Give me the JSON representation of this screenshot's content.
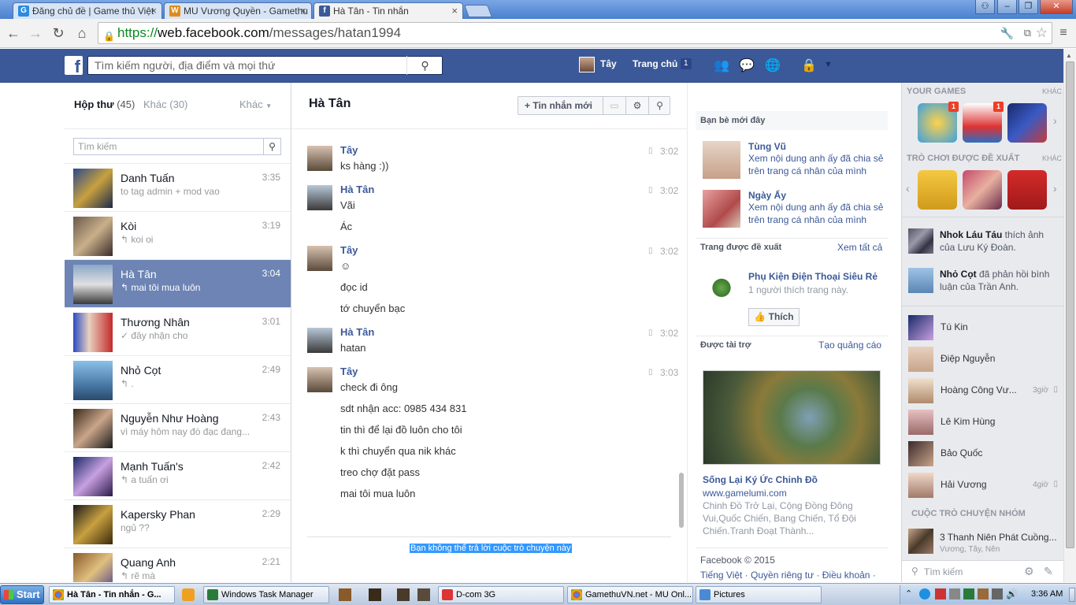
{
  "browser": {
    "tabs": [
      {
        "label": "Đăng chủ đề | Game thủ Việt",
        "icon": "g-icon"
      },
      {
        "label": "MU Vương Quyền - Gamethu",
        "icon": "mu-icon"
      },
      {
        "label": "Hà Tân - Tin nhắn",
        "icon": "facebook-icon"
      }
    ],
    "url_scheme": "https://",
    "url_host": "web.facebook.com",
    "url_path": "/messages/hatan1994"
  },
  "fb_header": {
    "search_placeholder": "Tìm kiếm người, địa điểm và mọi thứ",
    "user_name": "Tây",
    "home_label": "Trang chủ",
    "home_count": "1"
  },
  "inbox": {
    "tab_inbox": "Hộp thư",
    "tab_inbox_count": "(45)",
    "tab_other": "Khác",
    "tab_other_count": "(30)",
    "more_label": "Khác",
    "search_placeholder": "Tìm kiếm",
    "conversations": [
      {
        "name": "Danh Tuấn",
        "time": "3:35",
        "snippet": "to tag admin + mod vao",
        "selected": false
      },
      {
        "name": "Kòi",
        "time": "3:19",
        "snippet": "↰ koi oi",
        "selected": false
      },
      {
        "name": "Hà Tân",
        "time": "3:04",
        "snippet": "↰ mai tôi mua luôn",
        "selected": true
      },
      {
        "name": "Thương Nhân",
        "time": "3:01",
        "snippet": "✓ đây nhận cho",
        "selected": false
      },
      {
        "name": "Nhỏ Cọt",
        "time": "2:49",
        "snippet": "↰ .",
        "selected": false
      },
      {
        "name": "Nguyễn Như Hoàng",
        "time": "2:43",
        "snippet": "vì máy hôm nay đò đạc đang...",
        "selected": false
      },
      {
        "name": "Mạnh Tuấn's",
        "time": "2:42",
        "snippet": "↰ a tuấn ơi",
        "selected": false
      },
      {
        "name": "Kapersky Phan",
        "time": "2:29",
        "snippet": "ngủ ??",
        "selected": false
      },
      {
        "name": "Quang Anh",
        "time": "2:21",
        "snippet": "↰ rẽ mà",
        "selected": false
      }
    ]
  },
  "thread": {
    "title": "Hà Tân",
    "new_message_label": "Tin nhắn mới",
    "groups": [
      {
        "sender": "Tây",
        "time": "3:02",
        "lines": [
          "ks hàng :))"
        ]
      },
      {
        "sender": "Hà Tân",
        "time": "3:02",
        "lines": [
          "Vãi",
          "Ác"
        ]
      },
      {
        "sender": "Tây",
        "time": "3:02",
        "lines": [
          "☺",
          "đọc id",
          "tớ chuyển bạc"
        ]
      },
      {
        "sender": "Hà Tân",
        "time": "3:02",
        "lines": [
          "hatan"
        ]
      },
      {
        "sender": "Tây",
        "time": "3:03",
        "lines": [
          "check đi ông",
          "sdt nhận acc: 0985 434 831",
          "tin thì để lại đồ luôn cho tôi",
          "k thì chuyển qua nik khác",
          "treo chợ đặt pass",
          "mai tôi mua luôn"
        ]
      }
    ],
    "cannot_reply": "Bạn không thể trả lời cuộc trò chuyện này"
  },
  "right_column": {
    "recent_friends_title": "Bạn bè mới đây",
    "recent_friends": [
      {
        "name": "Tùng Vũ",
        "text": "Xem nội dung anh ấy đã chia sẻ trên trang cá nhân của mình"
      },
      {
        "name": "Ngày Ấy",
        "text": "Xem nội dung anh ấy đã chia sẻ trên trang cá nhân của mình"
      }
    ],
    "suggested_pages_title": "Trang được đề xuất",
    "see_all": "Xem tất cả",
    "page_name": "Phụ Kiện Điện Thoại Siêu Rẻ",
    "page_likes": "1 người thích trang này.",
    "like_button": "Thích",
    "sponsored_title": "Được tài trợ",
    "create_ad": "Tạo quảng cáo",
    "ad_title": "Sống Lại Ký Ức Chinh Đồ",
    "ad_url": "www.gamelumi.com",
    "ad_text": "Chinh Đồ Trở Lại, Cộng Đồng Đông Vui,Quốc Chiến, Bang Chiến, Tổ Đội Chiến.Tranh Đoạt Thành...",
    "footer_copyright": "Facebook © 2015",
    "footer_links": "Tiếng Việt · Quyền riêng tư · Điều khoản ·"
  },
  "chat_column": {
    "your_games": "YOUR GAMES",
    "games_more": "KHÁC",
    "suggested_games": "TRÒ CHƠI ĐƯỢC ĐỀ XUẤT",
    "suggested_more": "KHÁC",
    "game_badges": [
      "1",
      "1"
    ],
    "activities": [
      {
        "name": "Nhok Láu Táu",
        "text": " thích ảnh của Lưu Ký Đoàn."
      },
      {
        "name": "Nhỏ Cọt",
        "text": " đã phản hồi bình luận của Trần Anh."
      }
    ],
    "contacts": [
      {
        "name": "Tú Kin",
        "time": ""
      },
      {
        "name": "Điệp Nguyễn",
        "time": ""
      },
      {
        "name": "Hoàng Công Vư...",
        "time": "3giờ"
      },
      {
        "name": "Lê Kim Hùng",
        "time": ""
      },
      {
        "name": "Bảo Quốc",
        "time": ""
      },
      {
        "name": "Hải Vương",
        "time": "4giờ"
      }
    ],
    "group_title": "CUỘC TRÒ CHUYỆN NHÓM",
    "group_name": "3 Thanh Niên Phát Cuồng...",
    "group_members": "Vương, Tây, Nên",
    "search_placeholder": "Tìm kiếm"
  },
  "taskbar": {
    "start": "Start",
    "items": [
      "Hà Tân - Tin nhắn - G...",
      "Windows Task Manager",
      "D-com 3G",
      "GamethuVN.net - MU Onl...",
      "Pictures"
    ],
    "clock": "3:36 AM"
  }
}
